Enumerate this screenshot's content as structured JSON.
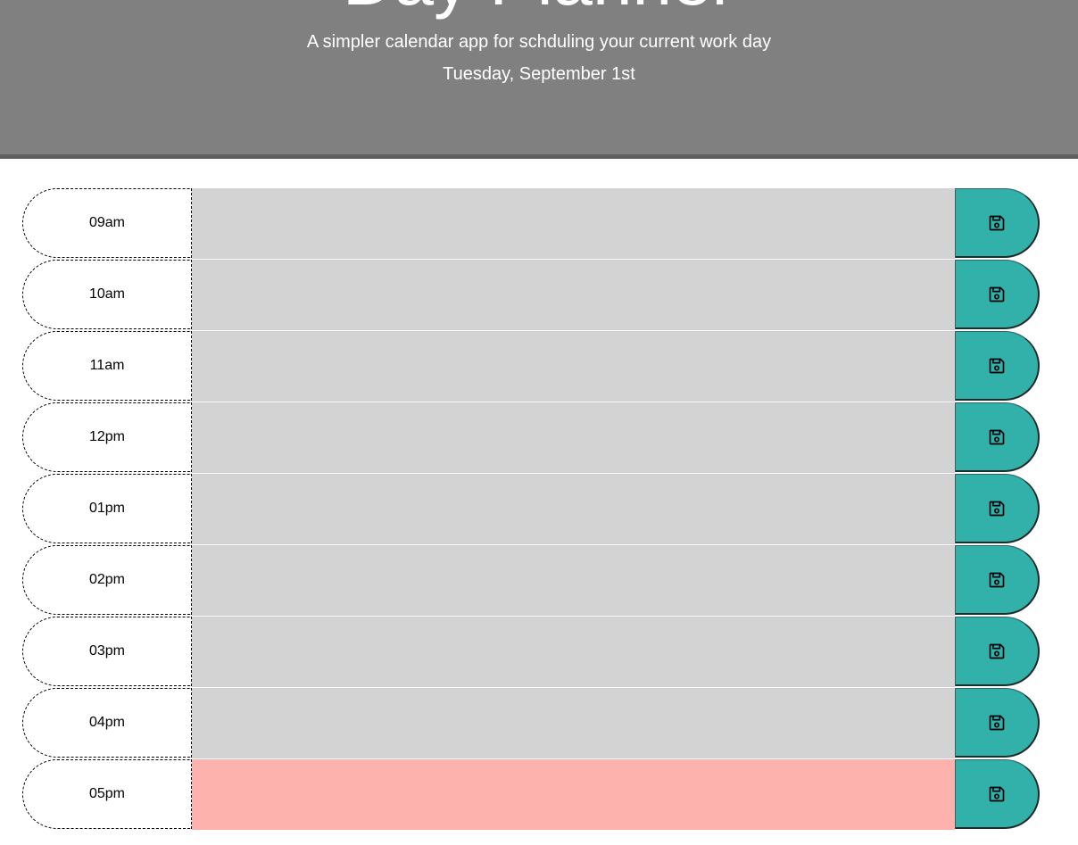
{
  "header": {
    "title": "Day Planner",
    "subtitle": "A simpler calendar app for schduling your current work day",
    "current_day": "Tuesday, September 1st"
  },
  "colors": {
    "header_bg": "#808080",
    "past": "#d3d3d3",
    "present": "#fdb2ad",
    "save_button": "#31b1aa"
  },
  "save_icon": "floppy-disk-icon",
  "time_blocks": [
    {
      "hour": "09am",
      "value": "",
      "status": "past"
    },
    {
      "hour": "10am",
      "value": "",
      "status": "past"
    },
    {
      "hour": "11am",
      "value": "",
      "status": "past"
    },
    {
      "hour": "12pm",
      "value": "",
      "status": "past"
    },
    {
      "hour": "01pm",
      "value": "",
      "status": "past"
    },
    {
      "hour": "02pm",
      "value": "",
      "status": "past"
    },
    {
      "hour": "03pm",
      "value": "",
      "status": "past"
    },
    {
      "hour": "04pm",
      "value": "",
      "status": "past"
    },
    {
      "hour": "05pm",
      "value": "",
      "status": "present"
    }
  ]
}
